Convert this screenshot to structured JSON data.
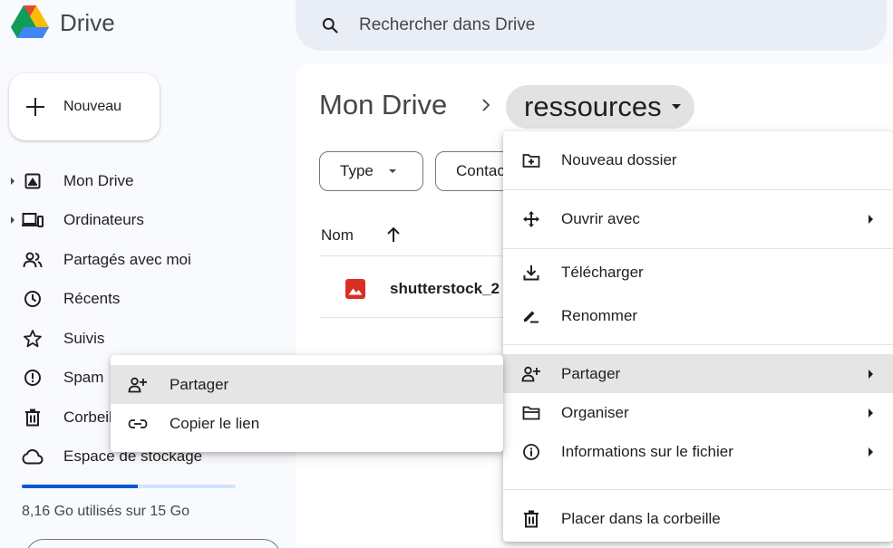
{
  "app": {
    "name": "Drive"
  },
  "search": {
    "placeholder": "Rechercher dans Drive"
  },
  "sidebar": {
    "new_button": "Nouveau",
    "items": [
      {
        "label": "Mon Drive",
        "icon": "my-drive-icon"
      },
      {
        "label": "Ordinateurs",
        "icon": "computers-icon"
      },
      {
        "label": "Partagés avec moi",
        "icon": "shared-icon"
      },
      {
        "label": "Récents",
        "icon": "recent-icon"
      },
      {
        "label": "Suivis",
        "icon": "star-icon"
      },
      {
        "label": "Spam",
        "icon": "spam-icon"
      },
      {
        "label": "Corbeille",
        "icon": "trash-icon"
      },
      {
        "label": "Espace de stockage",
        "icon": "cloud-icon"
      }
    ],
    "storage": {
      "text": "8,16 Go utilisés sur 15 Go",
      "used_fraction": 0.544
    }
  },
  "breadcrumb": {
    "root": "Mon Drive",
    "current": "ressources"
  },
  "filters": {
    "type": "Type",
    "contacts": "Contacts"
  },
  "file_list": {
    "column_name": "Nom",
    "files": [
      {
        "name": "shutterstock_2",
        "icon": "image-file-icon"
      }
    ]
  },
  "context_menu": {
    "items": [
      {
        "label": "Nouveau dossier",
        "icon": "new-folder-icon"
      },
      {
        "label": "Ouvrir avec",
        "icon": "open-with-icon"
      },
      {
        "label": "Télécharger",
        "icon": "download-icon"
      },
      {
        "label": "Renommer",
        "icon": "rename-icon"
      },
      {
        "label": "Partager",
        "icon": "share-icon"
      },
      {
        "label": "Organiser",
        "icon": "organize-icon"
      },
      {
        "label": "Informations sur le fichier",
        "icon": "info-icon"
      },
      {
        "label": "Placer dans la corbeille",
        "icon": "trash-icon"
      }
    ]
  },
  "share_submenu": {
    "items": [
      {
        "label": "Partager",
        "icon": "share-icon"
      },
      {
        "label": "Copier le lien",
        "icon": "link-icon"
      }
    ]
  },
  "colors": {
    "accent": "#0b57d0",
    "highlight": "#e5e5e5",
    "surface": "#f8fafd"
  }
}
